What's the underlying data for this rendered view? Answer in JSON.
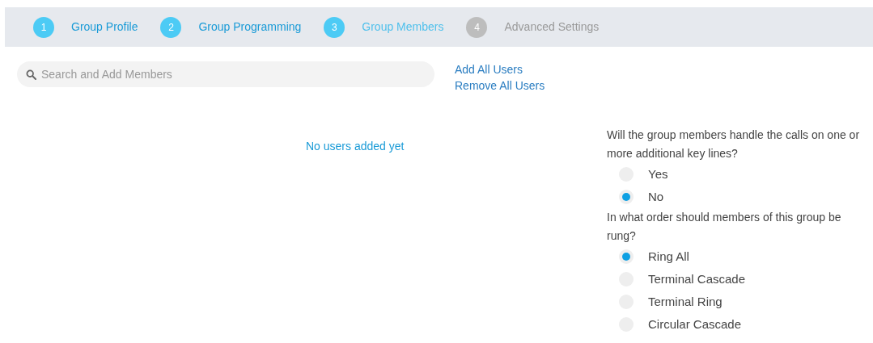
{
  "steps": [
    {
      "number": "1",
      "label": "Group Profile",
      "selected": false,
      "disabled": false
    },
    {
      "number": "2",
      "label": "Group Programming",
      "selected": false,
      "disabled": false
    },
    {
      "number": "3",
      "label": "Group Members",
      "selected": true,
      "disabled": false
    },
    {
      "number": "4",
      "label": "Advanced Settings",
      "selected": false,
      "disabled": true
    }
  ],
  "search": {
    "placeholder": "Search and Add Members"
  },
  "links": [
    "Add All Users",
    "Remove All Users"
  ],
  "empty_message": "No users added yet",
  "questions": [
    {
      "text": "Will the group members handle the calls on one or more additional key lines?",
      "options": [
        {
          "label": "Yes",
          "selected": false
        },
        {
          "label": "No",
          "selected": true
        }
      ]
    },
    {
      "text": "In what order should members of this group be rung?",
      "options": [
        {
          "label": "Ring All",
          "selected": true
        },
        {
          "label": "Terminal Cascade",
          "selected": false
        },
        {
          "label": "Terminal Ring",
          "selected": false
        },
        {
          "label": "Circular Cascade",
          "selected": false
        }
      ]
    }
  ]
}
